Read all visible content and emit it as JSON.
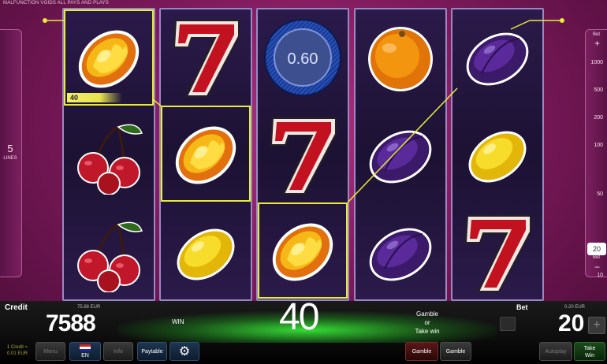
{
  "disclaimer": "MALFUNCTION VOIDS ALL PAYS AND PLAYS",
  "lines": {
    "count": "5",
    "label": "LINES"
  },
  "bet_panel": {
    "head": "Bet",
    "plus": "+",
    "minus": "−",
    "foot": "Bet",
    "ticks": [
      "1000",
      "500",
      "200",
      "100",
      "50",
      "20",
      "10"
    ],
    "selected": "20"
  },
  "reels": [
    [
      "fire-lemon",
      "cherry",
      "cherry"
    ],
    [
      "seven",
      "fire-lemon",
      "lemon"
    ],
    [
      "bonus-coin",
      "seven",
      "fire-lemon"
    ],
    [
      "orange",
      "plum",
      "plum"
    ],
    [
      "plum",
      "lemon",
      "seven"
    ]
  ],
  "win_label": "40",
  "coin_value": "0.60",
  "bottom": {
    "credit_label": "Credit",
    "credit_eur": "75.88 EUR",
    "credit_value": "7588",
    "win_label": "WIN",
    "win_value": "40",
    "gamble_text": [
      "Gamble",
      "or",
      "Take win"
    ],
    "bet_label": "Bet",
    "bet_eur": "0.20 EUR",
    "bet_value": "20",
    "credit_rate": [
      "1 Credit =",
      "0.01 EUR"
    ],
    "buttons": {
      "menu": "Menu",
      "lang": "EN",
      "info": "Info",
      "paytable": "Paytable",
      "gamble_red": "Gamble",
      "gamble_black": "Gamble",
      "autoplay": "Autoplay",
      "take_win": [
        "Take",
        "Win"
      ]
    }
  },
  "colors": {
    "payline": "#e7ed3a",
    "background": "#7d1a5c",
    "win_glow": "#3cff3c"
  }
}
